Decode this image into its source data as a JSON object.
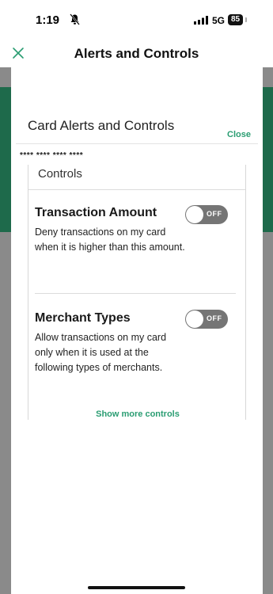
{
  "status_bar": {
    "time": "1:19",
    "network": "5G",
    "battery": "85"
  },
  "nav": {
    "title": "Alerts and Controls"
  },
  "sheet": {
    "title": "Card Alerts and Controls",
    "close_label": "Close",
    "card_number": "**** **** **** ****",
    "controls_heading": "Controls",
    "items": [
      {
        "title": "Transaction Amount",
        "description": "Deny transactions on my card when it is higher than this amount.",
        "toggle_label": "OFF",
        "enabled": false
      },
      {
        "title": "Merchant Types",
        "description": "Allow transactions on my card only when it is used at the following types of merchants.",
        "toggle_label": "OFF",
        "enabled": false
      }
    ],
    "show_more_label": "Show more controls"
  },
  "colors": {
    "accent_green": "#2a9d72",
    "header_green": "#1e6a4b",
    "toggle_off": "#757575",
    "overlay_gray": "#8a8a8a"
  },
  "icons": {
    "status_silent": "bell-off-icon",
    "status_signal": "signal-icon",
    "nav_close": "close-x-icon"
  }
}
